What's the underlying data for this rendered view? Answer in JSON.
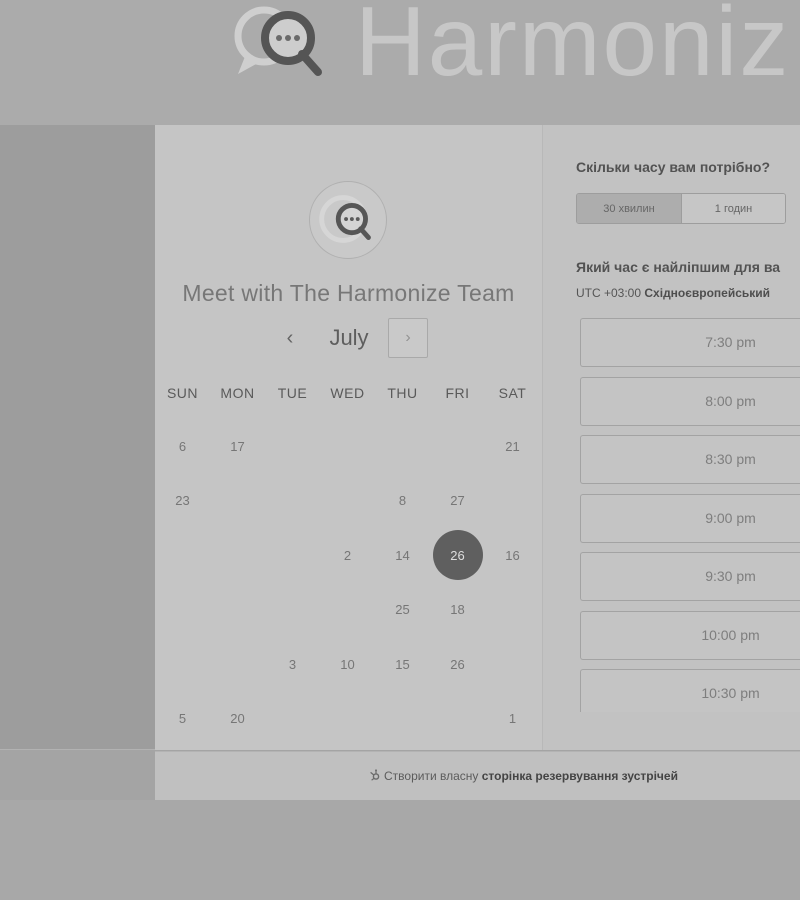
{
  "header": {
    "logo_icon": "harmonize-logo-icon",
    "logo_text": "Harmoniz"
  },
  "calendar": {
    "avatar_icon": "harmonize-logo-icon",
    "title": "Meet with The Harmonize Team",
    "prev_icon": "chevron-left-icon",
    "prev_glyph": "‹",
    "month": "July",
    "next_icon": "chevron-right-icon",
    "next_glyph": "›",
    "weekdays": [
      "SUN",
      "MON",
      "TUE",
      "WED",
      "THU",
      "FRI",
      "SAT"
    ],
    "weeks": [
      [
        "6",
        "17",
        "",
        "",
        "",
        "",
        "21"
      ],
      [
        "23",
        "",
        "",
        "",
        "8",
        "27",
        ""
      ],
      [
        "",
        "",
        "",
        "2",
        "14",
        "26",
        "16"
      ],
      [
        "",
        "",
        "",
        "",
        "25",
        "18",
        ""
      ],
      [
        "",
        "",
        "3",
        "10",
        "15",
        "26",
        ""
      ],
      [
        "5",
        "20",
        "",
        "",
        "",
        "",
        "1"
      ]
    ],
    "selected": {
      "week": 2,
      "weekday": 5
    }
  },
  "duration": {
    "question": "Скільки часу вам потрібно?",
    "options": [
      "30 хвилин",
      "1 годин"
    ],
    "selected_index": 0
  },
  "times": {
    "question": "Який час є найліпшим для ва",
    "timezone_code": "UTC +03:00",
    "timezone_name": "Східноєвропейський",
    "slots": [
      "7:30 pm",
      "8:00 pm",
      "8:30 pm",
      "9:00 pm",
      "9:30 pm",
      "10:00 pm",
      "10:30 pm"
    ]
  },
  "footer": {
    "icon": "hubspot-sprocket-icon",
    "prefix": "Створити власну",
    "link": "сторінка резервування зустрічей"
  },
  "colors": {
    "selected_day": "#5f5f5f",
    "selected_option": "#adadad"
  }
}
